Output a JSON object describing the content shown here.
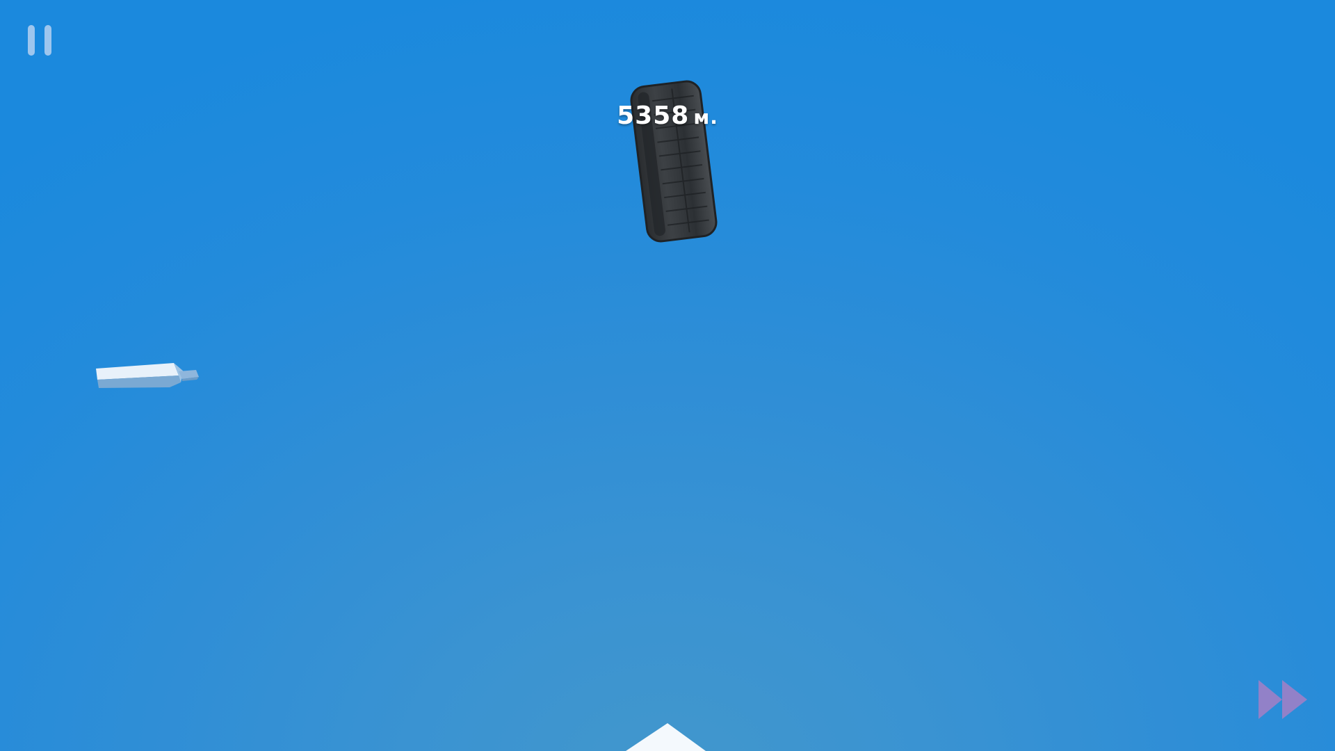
{
  "hud": {
    "distance_value": "5358",
    "distance_unit": "м.",
    "pause_icon": "pause-icon",
    "fast_forward_icon": "fast-forward-icon"
  },
  "scene": {
    "objects": [
      "tire",
      "plank",
      "ramp-tip"
    ]
  },
  "colors": {
    "sky_top": "#1b89dd",
    "sky_bottom": "#4297cc",
    "pause": "#9ec6ee",
    "fast_forward": "#a47fc6",
    "text": "#ffffff"
  }
}
